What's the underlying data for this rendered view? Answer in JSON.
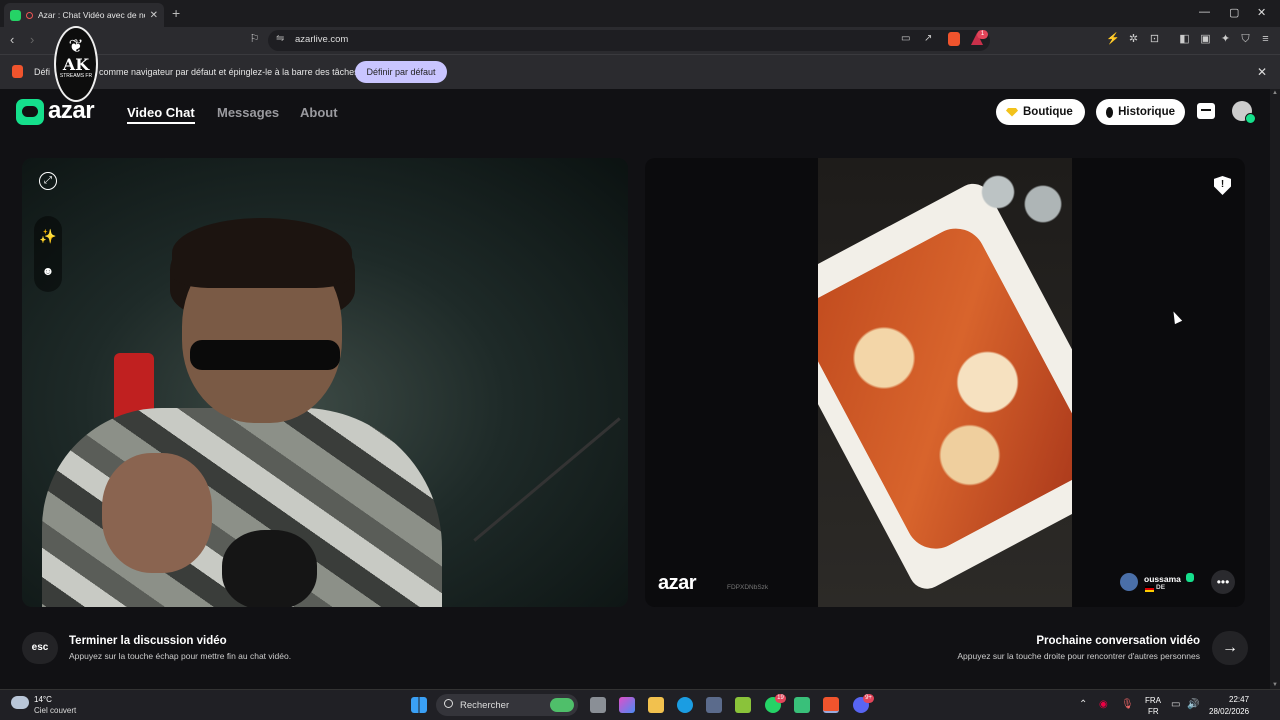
{
  "browser": {
    "tab_title": "Azar : Chat Vidéo avec de no",
    "tab_close": "✕",
    "new_tab": "+",
    "url": "azarlive.com",
    "window_controls": [
      "—",
      "▢",
      "✕"
    ],
    "infobar_text": "comme navigateur par défaut et épinglez-le à la barre des tâches",
    "infobar_prefix": "Défi",
    "infobar_button": "Définir par défaut",
    "infobar_close": "✕",
    "extension_badge": "1"
  },
  "overlay_logo": {
    "title": "AK",
    "subtitle": "STREAMS FR"
  },
  "app": {
    "logo_text": "azar",
    "nav": {
      "video_chat": "Video Chat",
      "messages": "Messages",
      "about": "About"
    },
    "buttons": {
      "boutique": "Boutique",
      "historique": "Historique"
    }
  },
  "partner": {
    "watermark_logo": "azar",
    "watermark_id": "FDPXDNbSzk",
    "name": "oussama",
    "country": "DE"
  },
  "controls": {
    "esc_key": "esc",
    "end_title": "Terminer la discussion vidéo",
    "end_subtitle": "Appuyez sur la touche échap pour mettre fin au chat vidéo.",
    "next_title": "Prochaine conversation vidéo",
    "next_subtitle": "Appuyez sur la touche droite pour rencontrer d'autres personnes",
    "next_arrow": "→"
  },
  "taskbar": {
    "temperature": "14°C",
    "weather": "Ciel couvert",
    "search": "Rechercher",
    "whatsapp_badge": "19",
    "discord_badge": "9+",
    "lang_line1": "FRA",
    "lang_line2": "FR",
    "time": "22:47",
    "date": "28/02/2026"
  },
  "colors": {
    "brand_green": "#15e08c",
    "infobar_button_bg": "#c9c5ff",
    "background": "#111114"
  }
}
